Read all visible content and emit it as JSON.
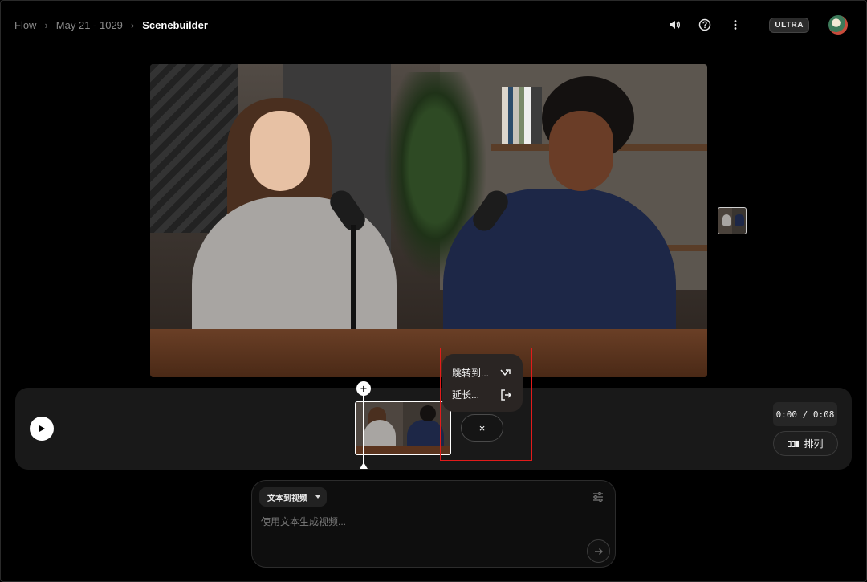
{
  "breadcrumb": {
    "items": [
      "Flow",
      "May 21 - 1029",
      "Scenebuilder"
    ]
  },
  "header": {
    "badge": "ULTRA",
    "icons": [
      "volume-icon",
      "help-icon",
      "more-vert-icon"
    ]
  },
  "context_menu": {
    "items": [
      {
        "label": "跳转到...",
        "icon": "jump-icon"
      },
      {
        "label": "延长...",
        "icon": "extend-icon"
      }
    ],
    "close_label": "×"
  },
  "timeline": {
    "time": "0:00 / 0:08",
    "arrange_label": "排列",
    "add_label": "+"
  },
  "prompt": {
    "mode_label": "文本到视频",
    "placeholder": "使用文本生成视频..."
  },
  "colors": {
    "highlight": "#e21b1b",
    "background": "#000000",
    "panel": "#191919"
  }
}
